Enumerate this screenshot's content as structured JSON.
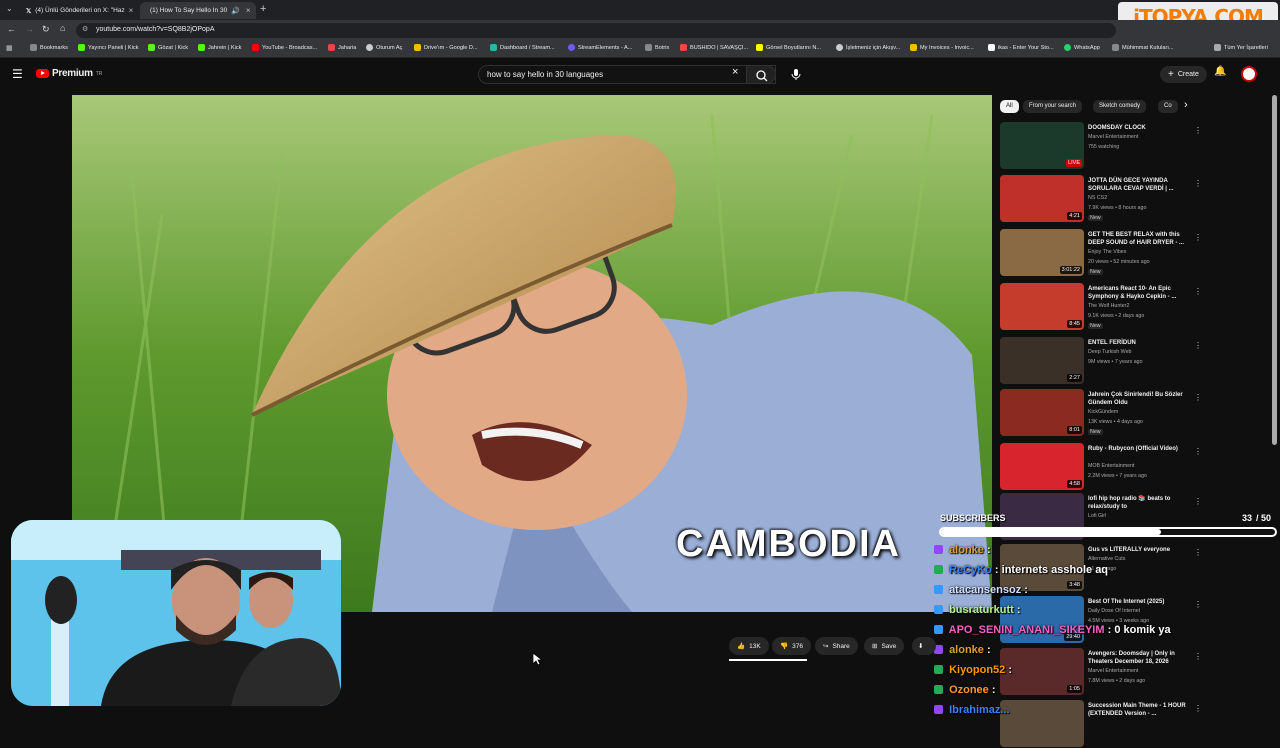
{
  "browser": {
    "tabs": [
      {
        "label": "(4) Ünlü Gönderileri on X: \"Haz"
      },
      {
        "label": "(1) How To Say Hello In 30"
      }
    ],
    "url": "youtube.com/watch?v=SQ8B2jOPopA",
    "bookmarks": [
      "Bookmarks",
      "Yayıncı Paneli | Kick",
      "Gözat | Kick",
      "Jahrein | Kick",
      "YouTube - Broadcas...",
      "Jaharia",
      "Oturum Aç",
      "Drive'ım - Google D...",
      "Dashboard / Stream...",
      "StreamElements - A...",
      "Botrix",
      "BUSHIDO | SAVAŞÇI...",
      "Görsel Boyutlarını N...",
      "İşletmeniz için Akışv...",
      "My Invoices - Invoic...",
      "ikas - Enter Your Sto...",
      "WhatsApp",
      "Mühimmat Kutuları...",
      "Tüm Yer İşaretleri"
    ],
    "watermark": "iTOPYA.COM"
  },
  "youtube": {
    "logo": "Premium",
    "logo_sup": "TR",
    "search_value": "how to say hello in 30 languages",
    "create_label": "Create",
    "video_caption": "CAMBODIA",
    "chips": [
      "All",
      "From your search",
      "Sketch comedy",
      "Co"
    ],
    "actions": {
      "like": "13K",
      "dislike": "376",
      "share": "Share",
      "save": "Save"
    },
    "recommendations": [
      {
        "title": "DOOMSDAY CLOCK",
        "channel": "Marvel Entertainment",
        "meta": "755 watching",
        "badge": "LIVE",
        "duration": ""
      },
      {
        "title": "JOTTA DÜN GECE YAYINDA SORULARA CEVAP VERDİ | ...",
        "channel": "NS CS2",
        "meta": "7.9K views • 8 hours ago",
        "extra": "New",
        "duration": "4:21"
      },
      {
        "title": "GET THE BEST RELAX with this DEEP SOUND of HAIR DRYER - ...",
        "channel": "Enjoy The Vibes",
        "meta": "20 views • 52 minutes ago",
        "extra": "New",
        "duration": "3:01:22"
      },
      {
        "title": "Americans React 10- An Epic Symphony & Hayko Cepkin - ...",
        "channel": "The Wolf Hunter2",
        "meta": "9.1K views • 2 days ago",
        "extra": "New",
        "duration": "8:45"
      },
      {
        "title": "ENTEL FERİDUN",
        "channel": "Deep Turkish Web",
        "meta": "9M views • 7 years ago",
        "duration": "2:27"
      },
      {
        "title": "Jahrein Çok Sinirlendi! Bu Sözler Gündem Oldu",
        "channel": "KickGündem",
        "meta": "13K views • 4 days ago",
        "extra": "New",
        "duration": "8:01"
      },
      {
        "title": "Ruby - Rubycon (Official Video)",
        "channel": "MOB Entertainment",
        "meta": "2.2M views • 7 years ago",
        "duration": "4:58"
      },
      {
        "title": "lofi hip hop radio 📚 beats to relax/study to",
        "channel": "Lofi Girl",
        "meta": "",
        "duration": ""
      },
      {
        "title": "Gus vs LITERALLY everyone",
        "channel": "Alternative Cuts",
        "meta": "• 1 year ago",
        "duration": "3:48"
      },
      {
        "title": "Best Of The Internet (2025)",
        "channel": "Daily Dose Of Internet",
        "meta": "4.5M views • 3 weeks ago",
        "duration": "29:40"
      },
      {
        "title": "Avengers: Doomsday | Only in Theaters December 18, 2026",
        "channel": "Marvel Entertainment",
        "meta": "7.8M views • 2 days ago",
        "duration": "1:05"
      },
      {
        "title": "Succession Main Theme - 1 HOUR (EXTENDED Version - ...",
        "channel": "",
        "meta": "",
        "duration": ""
      }
    ]
  },
  "stream_overlay": {
    "subs_label": "SUBSCRIBERS",
    "subs_count": "33",
    "subs_goal": "/ 50",
    "subs_progress": 0.66,
    "chat": [
      {
        "user": "alonke",
        "sep": " : ",
        "msg": "",
        "color": "#e0a030",
        "badge": "#9146ff"
      },
      {
        "user": "ReCyKo",
        "sep": " : ",
        "msg": "internets asshole aq",
        "color": "#3b82f6",
        "badge": "#22aa55"
      },
      {
        "user": "atacansensoz",
        "sep": " : ",
        "msg": "",
        "color": "#d0e0ff",
        "badge": "#3399ff"
      },
      {
        "user": "busraturkutt",
        "sep": " : ",
        "msg": "",
        "color": "#b0f090",
        "badge": "#3399ff"
      },
      {
        "user": "APO_SENIN_ANANI_SIKEYIM",
        "sep": " : ",
        "msg": "0 komik ya",
        "color": "#ff5ec8",
        "badge": "#3399ff"
      },
      {
        "user": "alonke",
        "sep": " : ",
        "msg": "",
        "color": "#e0a030",
        "badge": "#9146ff"
      },
      {
        "user": "Kiyopon52",
        "sep": " : ",
        "msg": "",
        "color": "#ff9900",
        "badge": "#22aa55"
      },
      {
        "user": "Ozonee",
        "sep": " : ",
        "msg": "",
        "color": "#ff9930",
        "badge": "#22aa55"
      },
      {
        "user": "Ibrahimaz...",
        "sep": "",
        "msg": "",
        "color": "#3b82f6",
        "badge": "#9146ff"
      }
    ]
  },
  "colors": {
    "yt_red": "#ff0000",
    "bg": "#0f0f0f",
    "chip_active": "#f1f1f1"
  }
}
